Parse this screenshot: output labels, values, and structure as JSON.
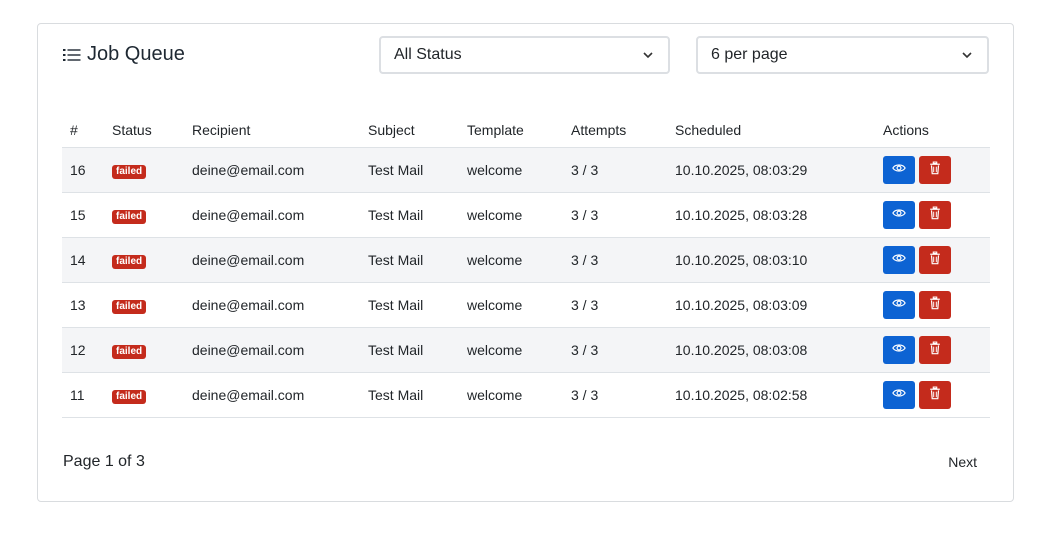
{
  "header": {
    "title": "Job Queue",
    "status_filter": "All Status",
    "per_page": "6 per page"
  },
  "table": {
    "columns": [
      "#",
      "Status",
      "Recipient",
      "Subject",
      "Template",
      "Attempts",
      "Scheduled",
      "Actions"
    ],
    "rows": [
      {
        "id": "16",
        "status": "failed",
        "recipient": "deine@email.com",
        "subject": "Test Mail",
        "template": "welcome",
        "attempts": "3 / 3",
        "scheduled": "10.10.2025, 08:03:29"
      },
      {
        "id": "15",
        "status": "failed",
        "recipient": "deine@email.com",
        "subject": "Test Mail",
        "template": "welcome",
        "attempts": "3 / 3",
        "scheduled": "10.10.2025, 08:03:28"
      },
      {
        "id": "14",
        "status": "failed",
        "recipient": "deine@email.com",
        "subject": "Test Mail",
        "template": "welcome",
        "attempts": "3 / 3",
        "scheduled": "10.10.2025, 08:03:10"
      },
      {
        "id": "13",
        "status": "failed",
        "recipient": "deine@email.com",
        "subject": "Test Mail",
        "template": "welcome",
        "attempts": "3 / 3",
        "scheduled": "10.10.2025, 08:03:09"
      },
      {
        "id": "12",
        "status": "failed",
        "recipient": "deine@email.com",
        "subject": "Test Mail",
        "template": "welcome",
        "attempts": "3 / 3",
        "scheduled": "10.10.2025, 08:03:08"
      },
      {
        "id": "11",
        "status": "failed",
        "recipient": "deine@email.com",
        "subject": "Test Mail",
        "template": "welcome",
        "attempts": "3 / 3",
        "scheduled": "10.10.2025, 08:02:58"
      }
    ]
  },
  "pagination": {
    "info": "Page 1 of 3",
    "next_label": "Next"
  },
  "icons": {
    "title": "list-icon",
    "dropdown": "chevron-down-icon",
    "view": "eye-icon",
    "delete": "trash-icon"
  },
  "colors": {
    "primary": "#0d63d3",
    "danger": "#c42b1c",
    "stripe": "#f4f5f7"
  }
}
